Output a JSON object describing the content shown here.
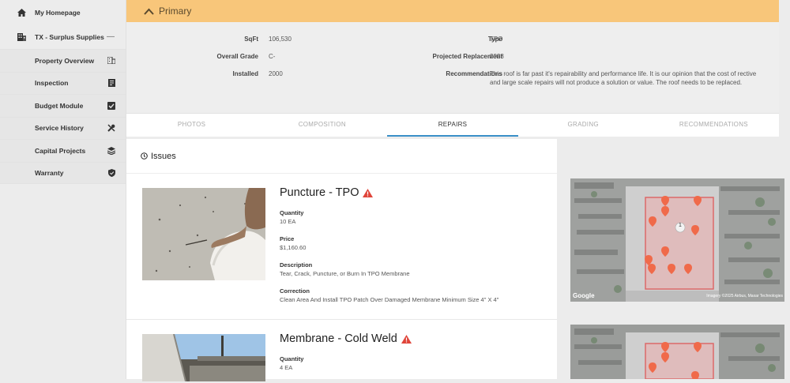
{
  "sidebar": {
    "home": {
      "label": "My Homepage",
      "icon": "home-icon"
    },
    "property": {
      "label": "TX - Surplus Supplies",
      "icon": "building-icon",
      "collapse": "—"
    },
    "items": [
      {
        "label": "Property Overview",
        "icon": "building-small-icon"
      },
      {
        "label": "Inspection",
        "icon": "report-icon"
      },
      {
        "label": "Budget Module",
        "icon": "checkbox-icon"
      },
      {
        "label": "Service History",
        "icon": "tools-icon"
      },
      {
        "label": "Capital Projects",
        "icon": "layers-icon"
      },
      {
        "label": "Warranty",
        "icon": "shield-check-icon"
      }
    ]
  },
  "banner": {
    "title": "Primary",
    "color": "#f8c67a"
  },
  "details": {
    "sqft_label": "SqFt",
    "sqft": "106,530",
    "grade_label": "Overall Grade",
    "grade": "C-",
    "installed_label": "Installed",
    "installed": "2000",
    "type_label": "Type",
    "type": "TPO",
    "replacement_label": "Projected Replacement",
    "replacement": "2028",
    "recommend_label": "Recommendations",
    "recommend_line1": "This roof is far past it's repairability and performance life. It is our opinion that the cost of rective",
    "recommend_line2": "and large scale repairs will not produce a solution or value. The roof needs to be replaced."
  },
  "tabs": [
    "PHOTOS",
    "COMPOSITION",
    "REPAIRS",
    "GRADING",
    "RECOMMENDATIONS"
  ],
  "active_tab": "REPAIRS",
  "accent": "#3a90c8",
  "issues": {
    "heading": "Issues",
    "list": [
      {
        "title": "Puncture - TPO",
        "quantity_label": "Quantity",
        "quantity": "10 EA",
        "price_label": "Price",
        "price": "$1,160.60",
        "description_label": "Description",
        "description": "Tear, Crack, Puncture, or  Burn In TPO Membrane",
        "correction_label": "Correction",
        "correction": "Clean Area And Install TPO Patch Over Damaged Membrane Minimum Size 4\" X 4\""
      },
      {
        "title": "Membrane - Cold Weld",
        "quantity_label": "Quantity",
        "quantity": "4 EA"
      }
    ]
  },
  "map": {
    "google": "Google",
    "credit": "Imagery ©2025 Airbus, Maxar Technologies",
    "marker": "1",
    "pin_color": "#f06a4a"
  }
}
